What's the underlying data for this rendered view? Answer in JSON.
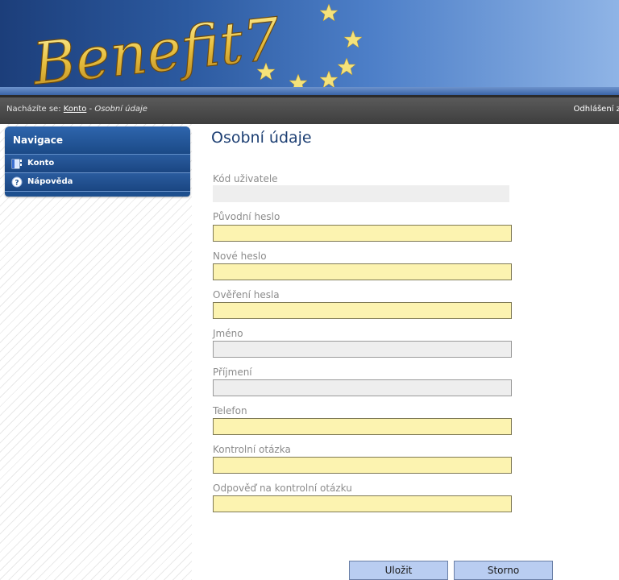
{
  "banner": {
    "logo_text": "Benefit7"
  },
  "breadcrumb": {
    "prefix": "Nacházíte se:",
    "link": "Konto",
    "separator": "-",
    "current": "Osobní údaje"
  },
  "header": {
    "logout_text": "Odhlášení za"
  },
  "sidebar": {
    "title": "Navigace",
    "items": [
      {
        "label": "Konto",
        "icon": "book-icon"
      },
      {
        "label": "Nápověda",
        "icon": "help-icon"
      }
    ]
  },
  "main": {
    "title": "Osobní údaje",
    "fields": [
      {
        "label": "Kód uživatele",
        "value": "",
        "style": "readonly"
      },
      {
        "label": "Původní heslo",
        "value": "",
        "style": "required"
      },
      {
        "label": "Nové heslo",
        "value": "",
        "style": "required"
      },
      {
        "label": "Ověření hesla",
        "value": "",
        "style": "required"
      },
      {
        "label": "Jméno",
        "value": "",
        "style": "disabled"
      },
      {
        "label": "Příjmení",
        "value": "",
        "style": "disabled"
      },
      {
        "label": "Telefon",
        "value": "",
        "style": "required"
      },
      {
        "label": "Kontrolní otázka",
        "value": "",
        "style": "required"
      },
      {
        "label": "Odpověď na kontrolní otázku",
        "value": "",
        "style": "required"
      }
    ],
    "save_label": "Uložit",
    "cancel_label": "Storno"
  },
  "colors": {
    "required_field": "#fcf3b0",
    "nav_blue": "#1d4f8e",
    "title_blue": "#1d3f73"
  }
}
